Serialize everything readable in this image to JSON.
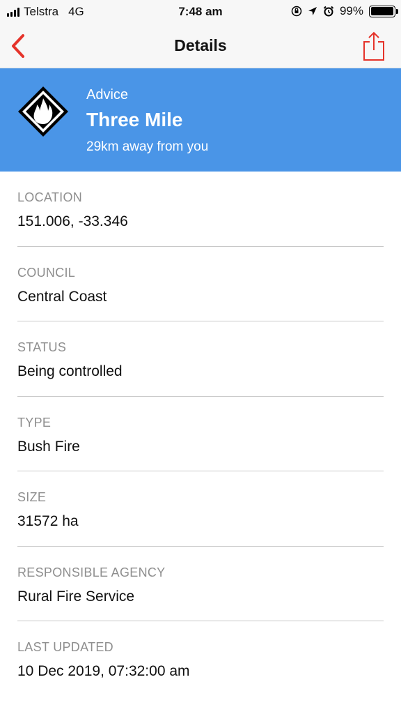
{
  "status_bar": {
    "carrier": "Telstra",
    "network": "4G",
    "time": "7:48 am",
    "battery": "99%",
    "battery_level": 0.99
  },
  "nav": {
    "title": "Details",
    "accent_color": "#e5332a"
  },
  "banner": {
    "level": "Advice",
    "name": "Three Mile",
    "distance": "29km away from you",
    "color": "#4a95e7"
  },
  "details": [
    {
      "label": "LOCATION",
      "value": "151.006, -33.346"
    },
    {
      "label": "COUNCIL",
      "value": "Central Coast"
    },
    {
      "label": "STATUS",
      "value": "Being controlled"
    },
    {
      "label": "TYPE",
      "value": "Bush Fire"
    },
    {
      "label": "SIZE",
      "value": "31572 ha"
    },
    {
      "label": "RESPONSIBLE AGENCY",
      "value": "Rural Fire Service"
    },
    {
      "label": "LAST UPDATED",
      "value": "10 Dec 2019, 07:32:00 am"
    }
  ]
}
